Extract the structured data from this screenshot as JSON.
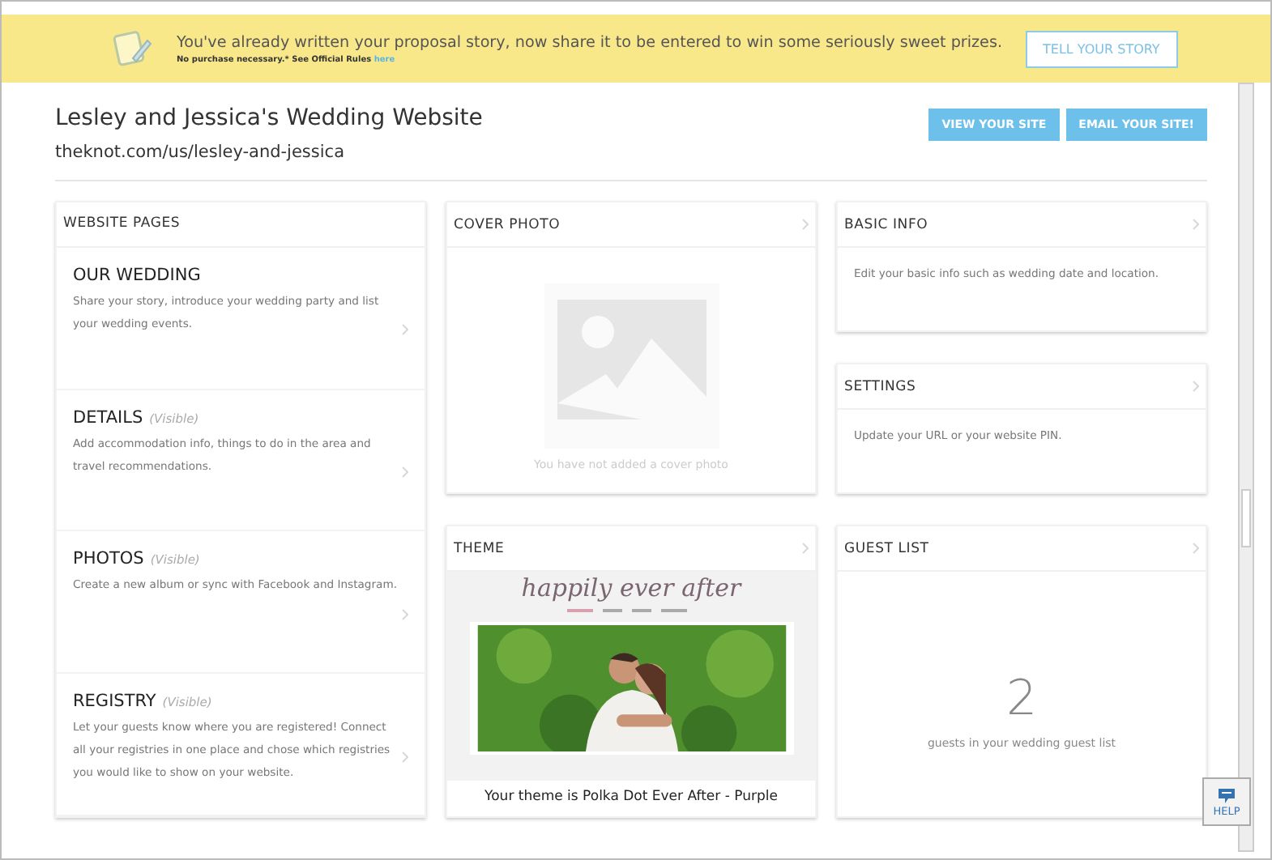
{
  "banner": {
    "message": "You've already written your proposal story, now share it to be entered to win some seriously sweet prizes.",
    "fine_print": "No purchase necessary.* See Official Rules",
    "fine_print_link": "here",
    "button": "TELL YOUR STORY"
  },
  "header": {
    "title": "Lesley and Jessica's Wedding Website",
    "url": "theknot.com/us/lesley-and-jessica",
    "buttons": [
      "VIEW YOUR SITE",
      "EMAIL YOUR SITE!"
    ]
  },
  "website_pages": {
    "title": "WEBSITE PAGES",
    "items": [
      {
        "title": "OUR WEDDING",
        "description": "Share your story, introduce your wedding party and list your wedding events."
      },
      {
        "title": "DETAILS",
        "status": "(Visible)",
        "description": "Add accommodation info, things to do in the area and travel recommendations."
      },
      {
        "title": "PHOTOS",
        "status": "(Visible)",
        "description": "Create a new album or sync with Facebook and Instagram."
      },
      {
        "title": "REGISTRY",
        "status": "(Visible)",
        "description": "Let your guests know where you are registered! Connect all your registries in one place and chose which registries you would like to show on your website."
      }
    ]
  },
  "cover_photo": {
    "title": "COVER PHOTO",
    "empty_text": "You have not added a cover photo"
  },
  "theme": {
    "title": "THEME",
    "preview_heading": "happily ever after",
    "caption": "Your theme is Polka Dot Ever After - Purple"
  },
  "basic_info": {
    "title": "BASIC INFO",
    "description": "Edit your basic info such as wedding date and location."
  },
  "settings": {
    "title": "SETTINGS",
    "description": "Update your URL or your website PIN."
  },
  "guest_list": {
    "title": "GUEST LIST",
    "count": "2",
    "description": "guests in your wedding guest list"
  },
  "help_button": "HELP"
}
